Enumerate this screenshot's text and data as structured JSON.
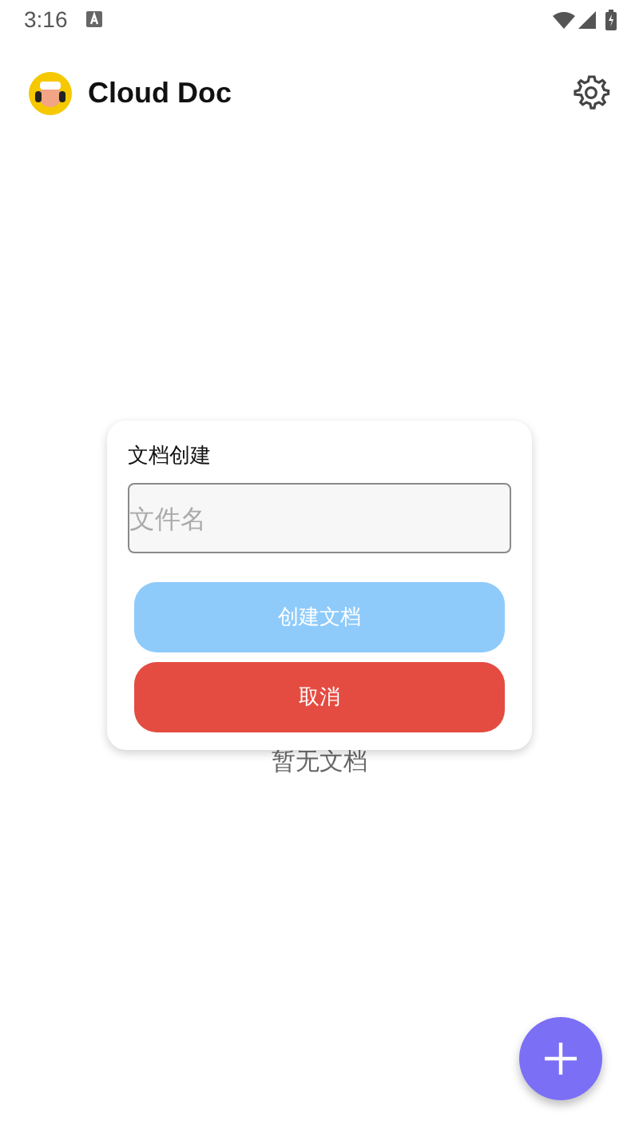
{
  "status_bar": {
    "time": "3:16"
  },
  "app_bar": {
    "title": "Cloud Doc"
  },
  "empty_message": "暂无文档",
  "dialog": {
    "title": "文档创建",
    "field": {
      "placeholder": "文件名"
    },
    "buttons": [
      {
        "label": "创建文档",
        "kind": "primary"
      },
      {
        "label": "取消",
        "kind": "danger"
      }
    ]
  }
}
